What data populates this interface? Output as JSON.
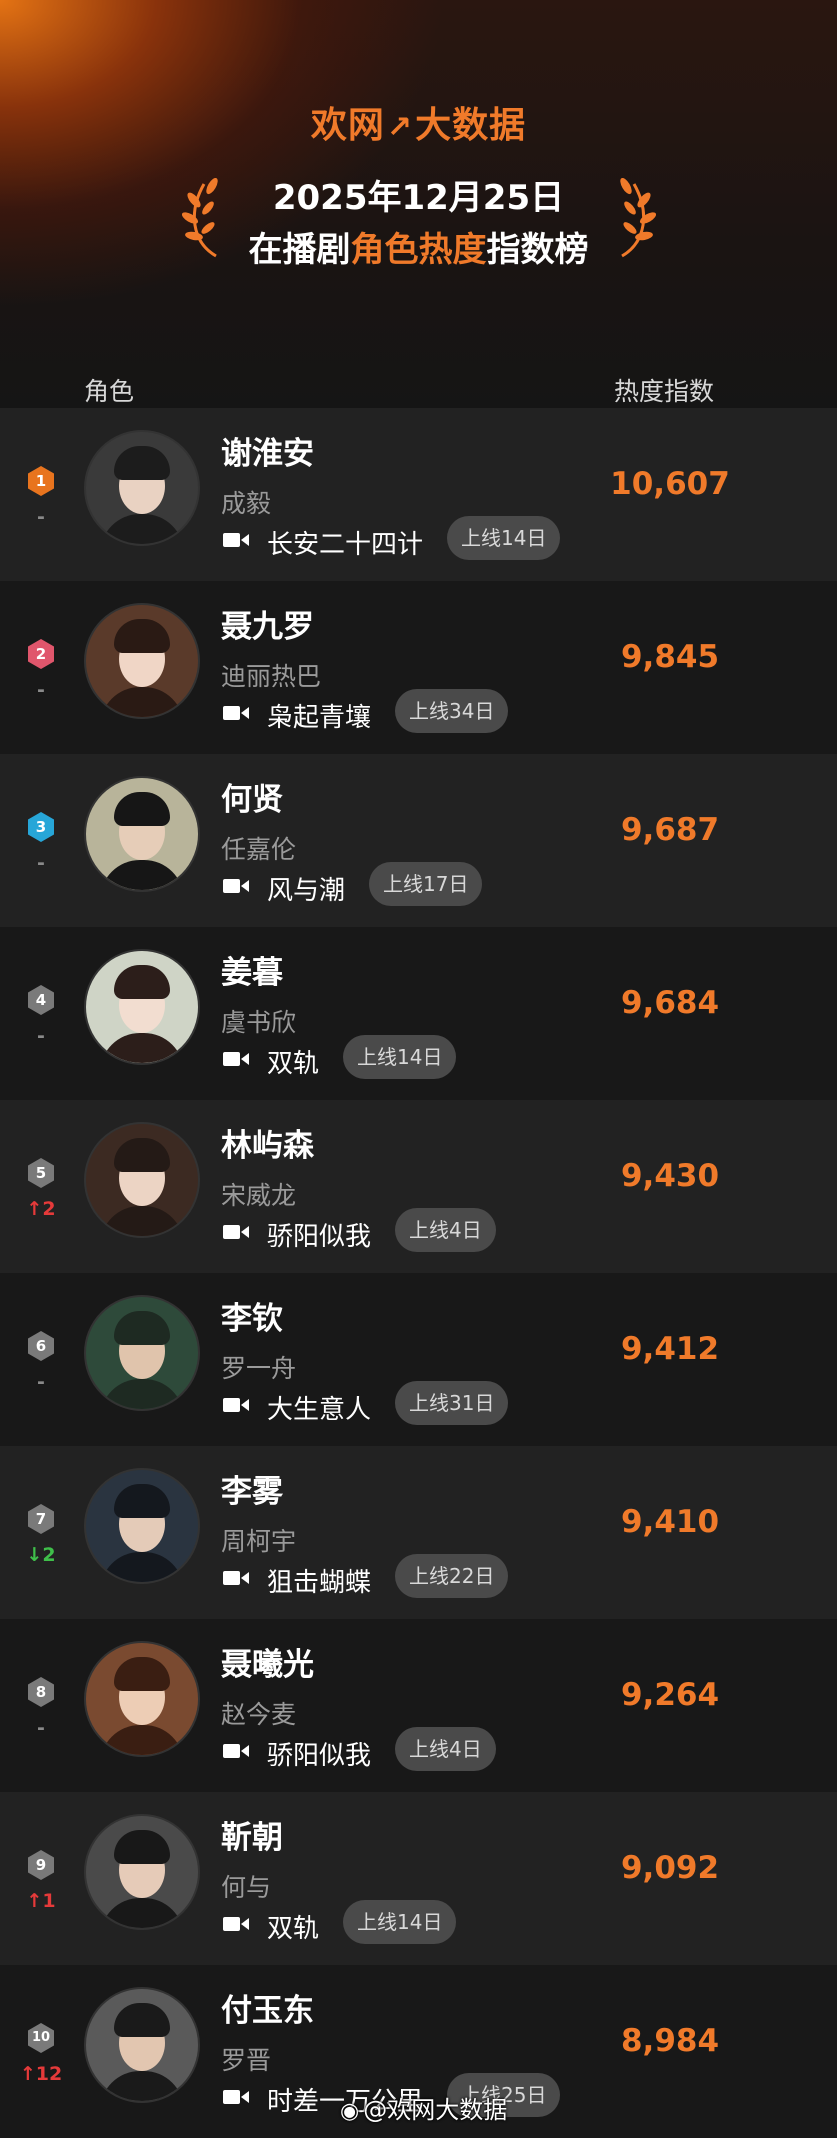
{
  "header": {
    "brand": "欢网大数据",
    "brand_left": "欢网",
    "brand_right": "大数据",
    "date": "2025年12月25日",
    "title_prefix": "在播剧",
    "title_highlight": "角色热度",
    "title_suffix": "指数榜"
  },
  "columns": {
    "role": "角色",
    "heat": "热度指数"
  },
  "colors": {
    "accent": "#f07a2a",
    "rank1": "#e8741e",
    "rank2": "#e0566c",
    "rank3": "#27a6d8",
    "rank_other": "#7a7a7a",
    "rise": "#e53a3a",
    "fall": "#3fbf4a"
  },
  "rows": [
    {
      "rank": "1",
      "change": "-",
      "trend": "same",
      "character": "谢淮安",
      "actor": "成毅",
      "drama": "长安二十四计",
      "online": "上线14日",
      "score": "10,607"
    },
    {
      "rank": "2",
      "change": "-",
      "trend": "same",
      "character": "聂九罗",
      "actor": "迪丽热巴",
      "drama": "枭起青壤",
      "online": "上线34日",
      "score": "9,845"
    },
    {
      "rank": "3",
      "change": "-",
      "trend": "same",
      "character": "何贤",
      "actor": "任嘉伦",
      "drama": "风与潮",
      "online": "上线17日",
      "score": "9,687"
    },
    {
      "rank": "4",
      "change": "-",
      "trend": "same",
      "character": "姜暮",
      "actor": "虞书欣",
      "drama": "双轨",
      "online": "上线14日",
      "score": "9,684"
    },
    {
      "rank": "5",
      "change": "↑2",
      "trend": "up",
      "character": "林屿森",
      "actor": "宋威龙",
      "drama": "骄阳似我",
      "online": "上线4日",
      "score": "9,430"
    },
    {
      "rank": "6",
      "change": "-",
      "trend": "same",
      "character": "李钦",
      "actor": "罗一舟",
      "drama": "大生意人",
      "online": "上线31日",
      "score": "9,412"
    },
    {
      "rank": "7",
      "change": "↓2",
      "trend": "down",
      "character": "李雾",
      "actor": "周柯宇",
      "drama": "狙击蝴蝶",
      "online": "上线22日",
      "score": "9,410"
    },
    {
      "rank": "8",
      "change": "-",
      "trend": "same",
      "character": "聂曦光",
      "actor": "赵今麦",
      "drama": "骄阳似我",
      "online": "上线4日",
      "score": "9,264"
    },
    {
      "rank": "9",
      "change": "↑1",
      "trend": "up",
      "character": "靳朝",
      "actor": "何与",
      "drama": "双轨",
      "online": "上线14日",
      "score": "9,092"
    },
    {
      "rank": "10",
      "change": "↑12",
      "trend": "up",
      "character": "付玉东",
      "actor": "罗晋",
      "drama": "时差一万公里",
      "online": "上线25日",
      "score": "8,984"
    }
  ],
  "watermark": "@欢网大数据"
}
